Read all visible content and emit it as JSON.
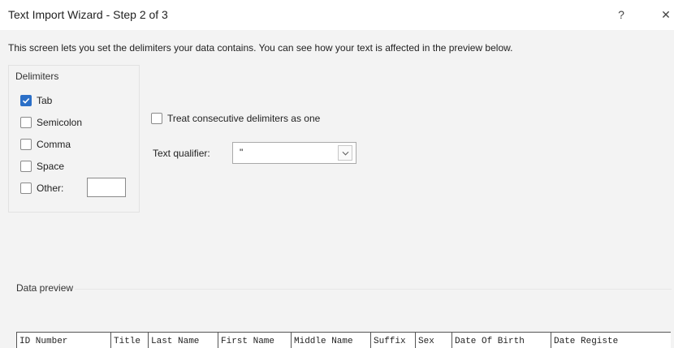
{
  "window": {
    "title": "Text Import Wizard - Step 2 of 3",
    "help_glyph": "?",
    "close_glyph": "✕"
  },
  "instructions": "This screen lets you set the delimiters your data contains.  You can see how your text is affected in the preview below.",
  "delimiters": {
    "caption": "Delimiters",
    "options": [
      {
        "label": "Tab",
        "checked": true
      },
      {
        "label": "Semicolon",
        "checked": false
      },
      {
        "label": "Comma",
        "checked": false
      },
      {
        "label": "Space",
        "checked": false
      },
      {
        "label": "Other:",
        "checked": false
      }
    ],
    "other_value": ""
  },
  "consecutive": {
    "label": "Treat consecutive delimiters as one",
    "checked": false
  },
  "qualifier": {
    "label": "Text qualifier:",
    "value": "\""
  },
  "preview": {
    "caption": "Data preview",
    "headers": [
      "ID Number",
      "Title",
      "Last Name",
      "First Name",
      "Middle Name",
      "Suffix",
      "Sex",
      "Date Of Birth",
      "Date Registe"
    ]
  },
  "colors": {
    "accent": "#2b6fc7"
  }
}
